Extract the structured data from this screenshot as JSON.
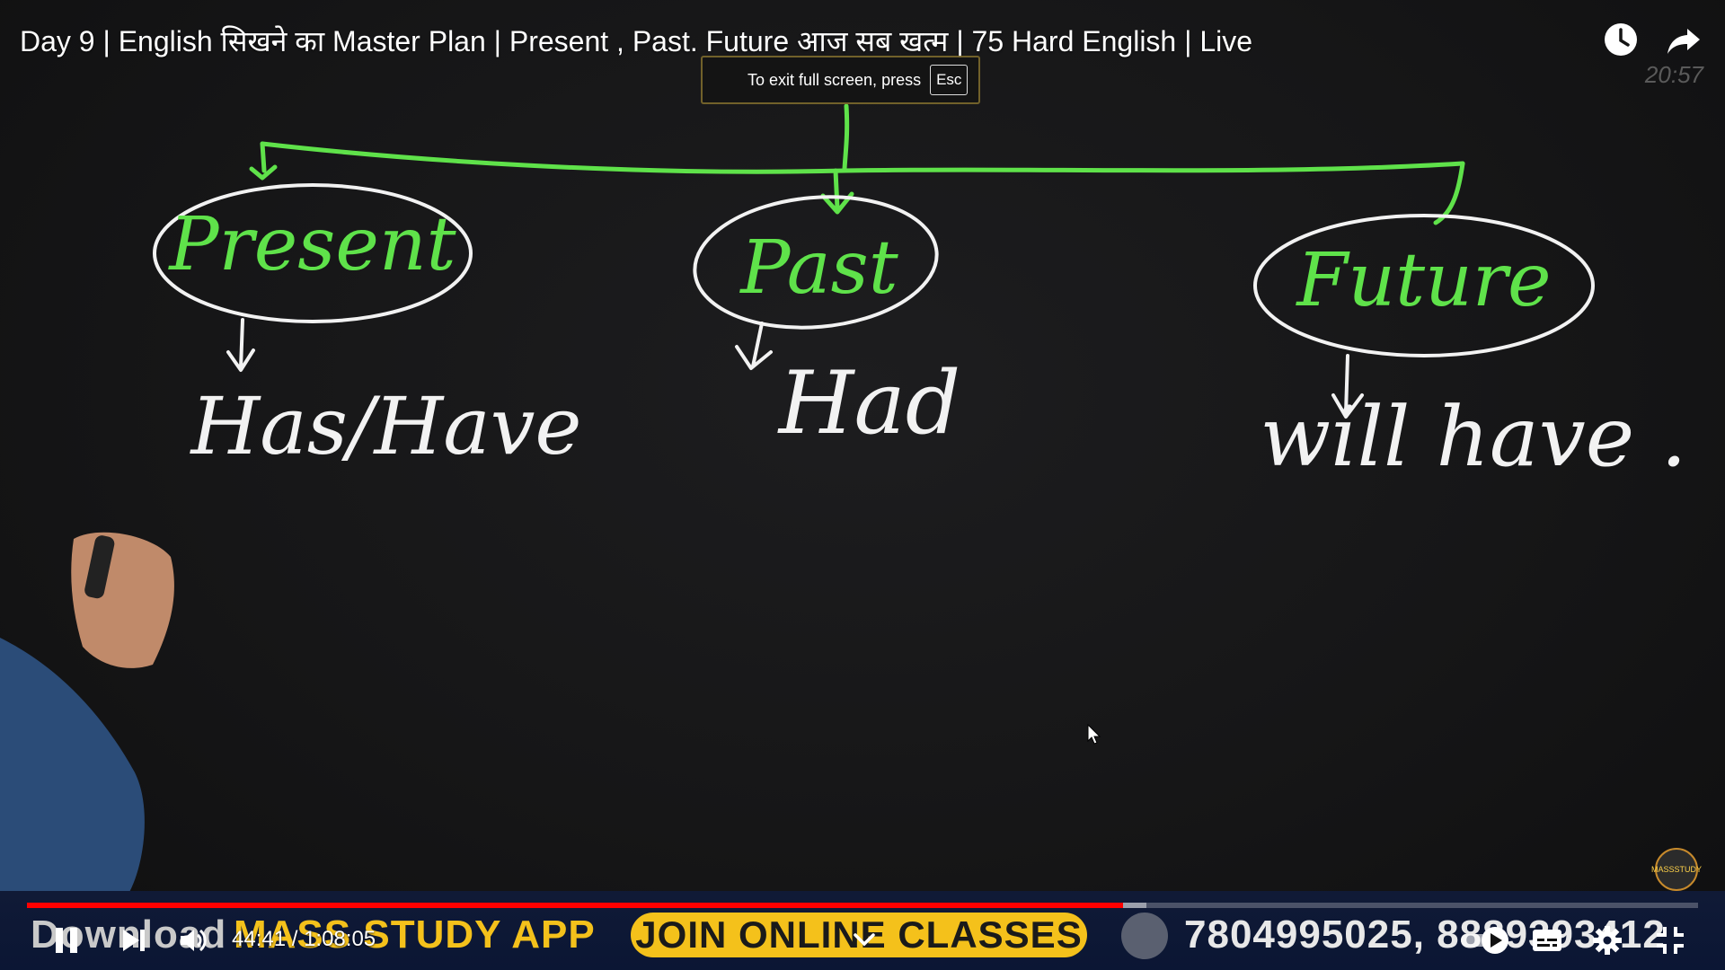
{
  "video": {
    "title": "Day 9 | English सिखने का Master Plan | Present , Past. Future आज सब खत्म | 75 Hard English | Live",
    "clock": "20:57",
    "fullscreen_hint": {
      "text": "To exit full screen, press",
      "key": "Esc"
    }
  },
  "board": {
    "nodes": [
      {
        "label": "Present",
        "detail": "Has/Have"
      },
      {
        "label": "Past",
        "detail": "Had"
      },
      {
        "label": "Future",
        "detail": "will have ."
      }
    ],
    "colors": {
      "chalk_green": "#5fe24a",
      "chalk_white": "#f2f2f2"
    }
  },
  "banner": {
    "download_prefix": "Download",
    "app_name": "MASS STUDY APP",
    "join_label": "JOIN ONLINE CLASSES",
    "phones": "7804995025, 8889393412",
    "logo_text": "MASS STUDY"
  },
  "player": {
    "current_time": "44:41",
    "duration": "1:08:05",
    "time_display": "44:41 / 1:08:05",
    "progress": 0.656,
    "buffered": 0.67,
    "accent": "#ff0000",
    "icons": [
      "pause-icon",
      "next-icon",
      "volume-icon",
      "chevron-down-icon",
      "autoplay-toggle",
      "captions-icon",
      "settings-icon",
      "exit-fullscreen-icon",
      "watch-later-icon",
      "share-icon"
    ]
  }
}
